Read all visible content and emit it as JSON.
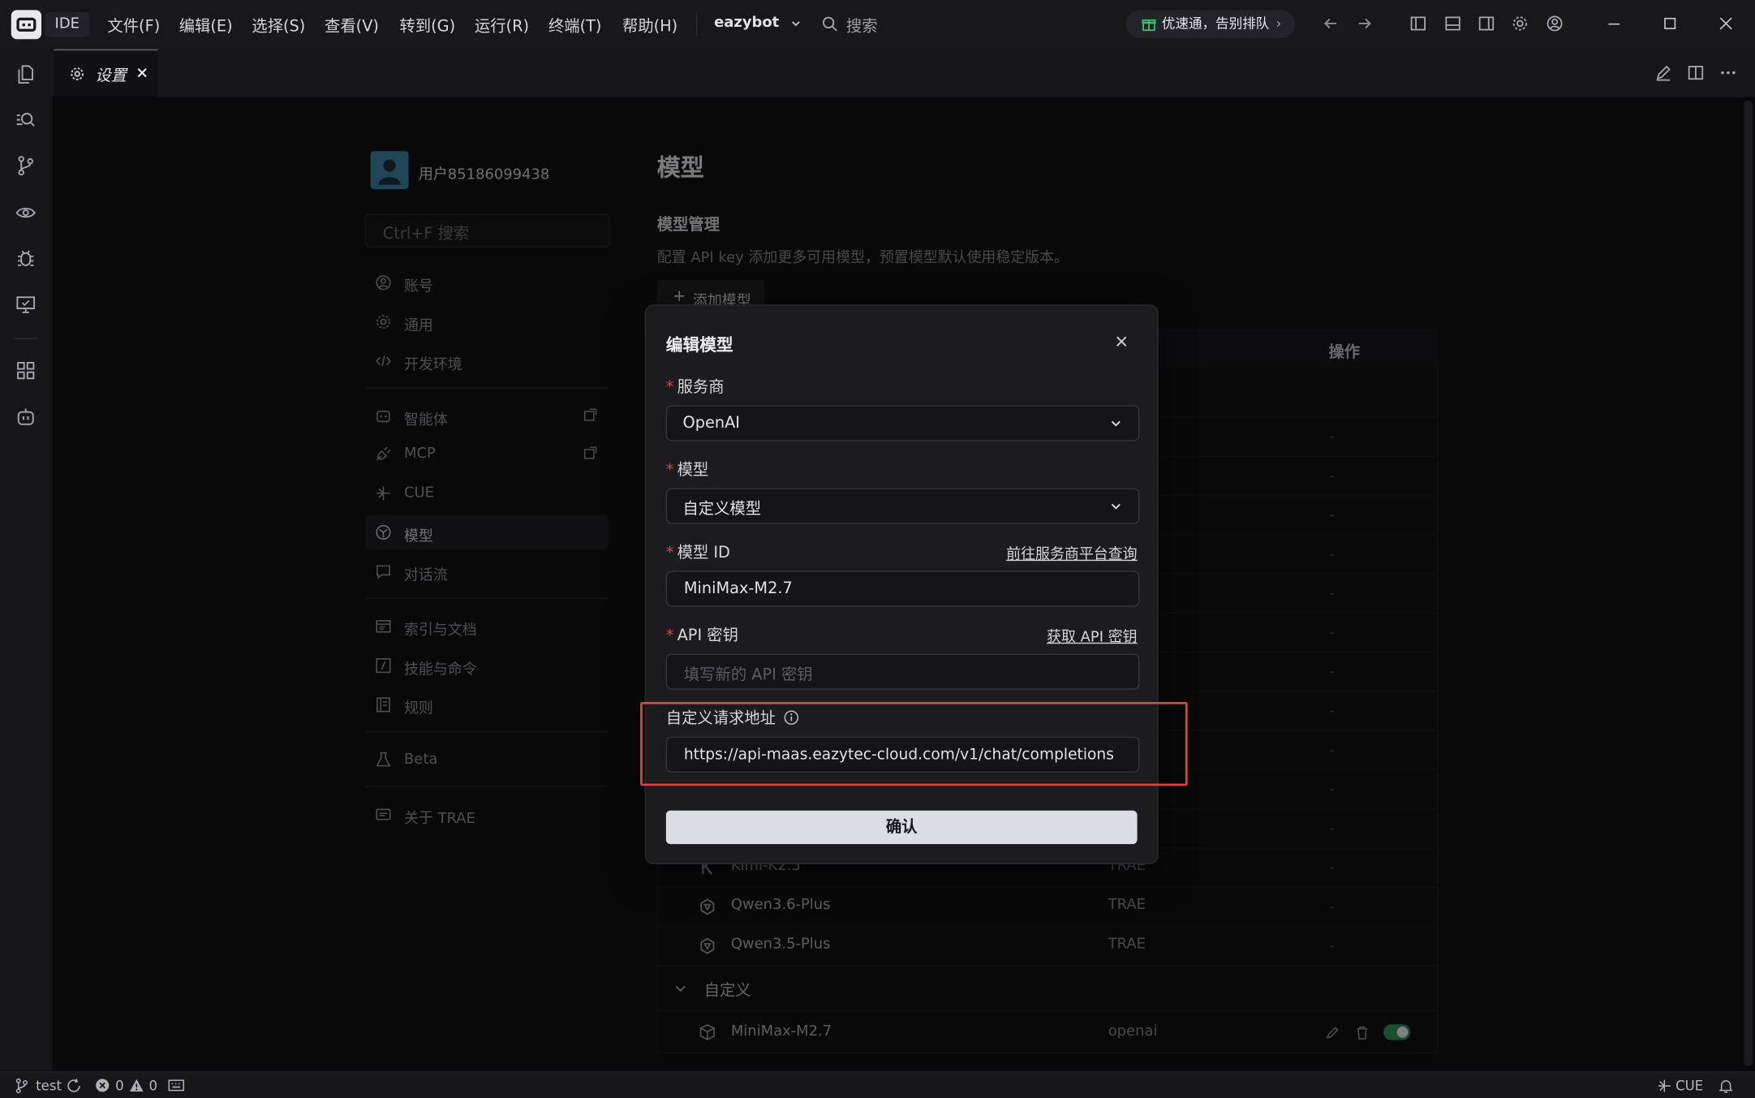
{
  "titlebar": {
    "ide_label": "IDE",
    "menus": [
      "文件(F)",
      "编辑(E)",
      "选择(S)",
      "查看(V)",
      "转到(G)",
      "运行(R)",
      "终端(T)",
      "帮助(H)"
    ],
    "project": "eazybot",
    "search_placeholder": "搜索",
    "promo": "优速通，告别排队"
  },
  "tab": {
    "label": "设置"
  },
  "settings": {
    "user_name": "用户85186099438",
    "search_placeholder": "Ctrl+F 搜索",
    "nav": [
      {
        "label": "账号",
        "icon": "user-circle-icon"
      },
      {
        "label": "通用",
        "icon": "gear-icon"
      },
      {
        "label": "开发环境",
        "icon": "code-icon"
      },
      {
        "label": "智能体",
        "icon": "agent-icon"
      },
      {
        "label": "MCP",
        "icon": "plug-icon"
      },
      {
        "label": "CUE",
        "icon": "cue-icon"
      },
      {
        "label": "模型",
        "icon": "model-icon"
      },
      {
        "label": "对话流",
        "icon": "chat-icon"
      },
      {
        "label": "索引与文档",
        "icon": "index-icon"
      },
      {
        "label": "技能与命令",
        "icon": "skill-icon"
      },
      {
        "label": "规则",
        "icon": "rules-icon"
      },
      {
        "label": "Beta",
        "icon": "flask-icon"
      },
      {
        "label": "关于 TRAE",
        "icon": "info-icon"
      }
    ]
  },
  "main": {
    "title": "模型",
    "section_title": "模型管理",
    "description": "配置 API key 添加更多可用模型，预置模型默认使用稳定版本。",
    "add_button": "添加模型",
    "col_actions": "操作",
    "rows": [
      {
        "name": "Kimi-K2.5",
        "provider": "TRAE",
        "action": "-",
        "icon": "kimi-icon"
      },
      {
        "name": "Qwen3.6-Plus",
        "provider": "TRAE",
        "action": "-",
        "icon": "qwen-icon"
      },
      {
        "name": "Qwen3.5-Plus",
        "provider": "TRAE",
        "action": "-",
        "icon": "qwen-icon"
      }
    ],
    "dash": "-",
    "custom_group": "自定义",
    "custom_row": {
      "name": "MiniMax-M2.7",
      "provider": "openai",
      "enabled": true
    }
  },
  "dialog": {
    "title": "编辑模型",
    "provider_label": "服务商",
    "provider_value": "OpenAI",
    "model_label": "模型",
    "model_value": "自定义模型",
    "model_id_label": "模型 ID",
    "model_id_link": "前往服务商平台查询",
    "model_id_value": "MiniMax-M2.7",
    "api_key_label": "API 密钥",
    "api_key_link": "获取 API 密钥",
    "api_key_placeholder": "填写新的 API 密钥",
    "custom_url_label": "自定义请求地址",
    "custom_url_value": "https://api-maas.eazytec-cloud.com/v1/chat/completions",
    "confirm": "确认",
    "required_mark": "*",
    "highlight_color": "#e5403a"
  },
  "statusbar": {
    "branch": "test",
    "errors": "0",
    "warnings": "0",
    "cue": "CUE"
  }
}
